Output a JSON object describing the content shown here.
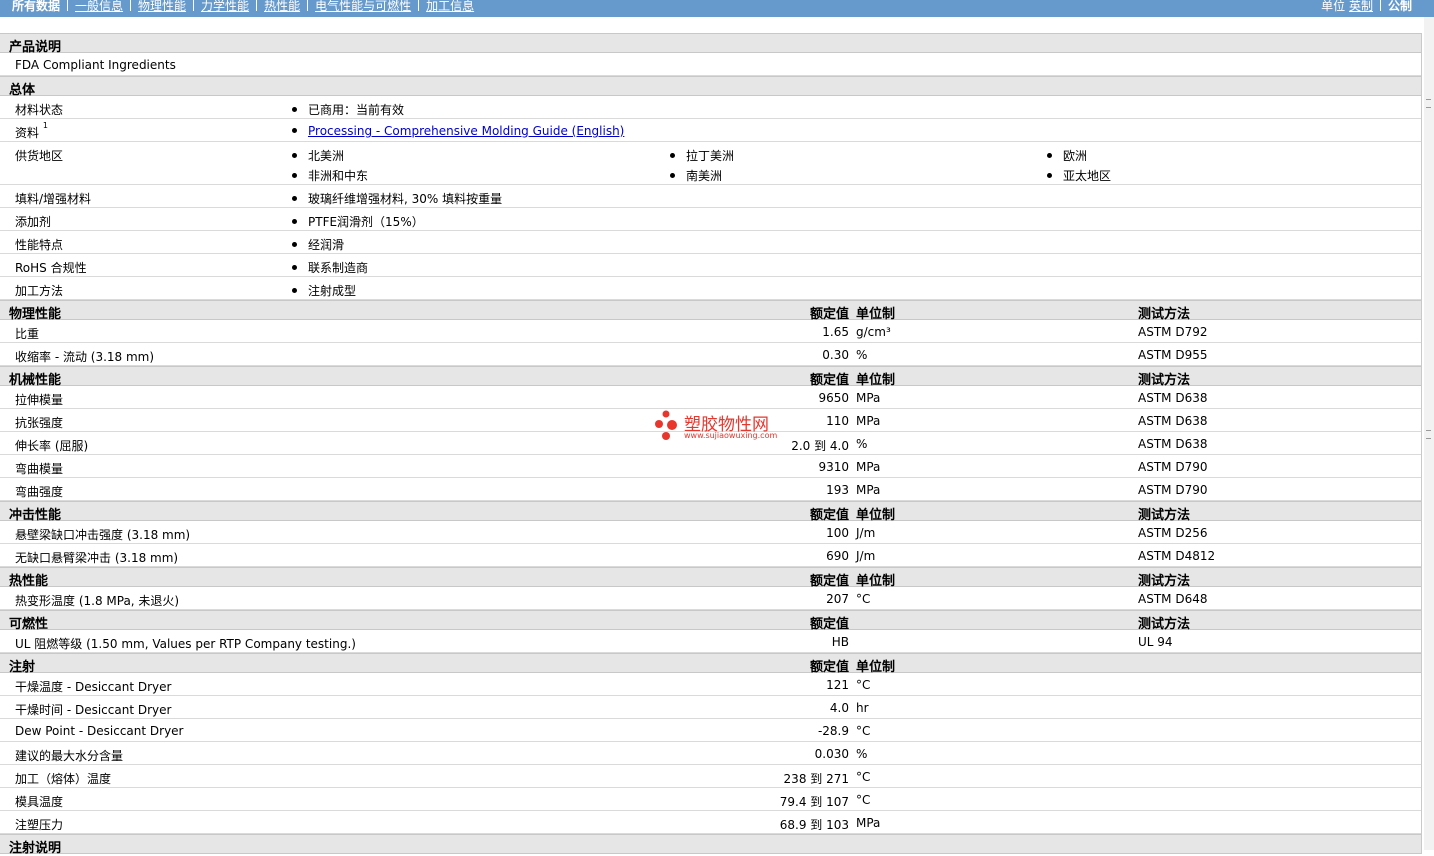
{
  "nav": {
    "tabs": [
      {
        "label": "所有数据",
        "active": true
      },
      {
        "label": "一般信息",
        "active": false
      },
      {
        "label": "物理性能",
        "active": false
      },
      {
        "label": "力学性能",
        "active": false
      },
      {
        "label": "热性能",
        "active": false
      },
      {
        "label": "电气性能与可燃性",
        "active": false
      },
      {
        "label": "加工信息",
        "active": false
      }
    ],
    "units_label": "单位",
    "units_imperial": "英制",
    "units_metric": "公制"
  },
  "watermark": {
    "name": "塑胶物性网",
    "url": "www.sujiaowuxing.com"
  },
  "product_description": {
    "title": "产品说明",
    "text": "FDA Compliant Ingredients"
  },
  "general": {
    "title": "总体",
    "material_status": {
      "label": "材料状态",
      "value": "已商用：当前有效"
    },
    "literature": {
      "label": "资料",
      "sup": "1",
      "link": "Processing - Comprehensive Molding Guide (English)"
    },
    "supply_region": {
      "label": "供货地区",
      "regions": [
        "北美洲",
        "拉丁美洲",
        "欧洲",
        "非洲和中东",
        "南美洲",
        "亚太地区"
      ]
    },
    "filler": {
      "label": "填料/增强材料",
      "value": "玻璃纤维增强材料, 30% 填料按重量"
    },
    "additive": {
      "label": "添加剂",
      "value": "PTFE润滑剂（15%）"
    },
    "features": {
      "label": "性能特点",
      "value": "经润滑"
    },
    "rohs": {
      "label": "RoHS 合规性",
      "value": "联系制造商"
    },
    "processing_method": {
      "label": "加工方法",
      "value": "注射成型"
    }
  },
  "headers": {
    "nominal": "额定值",
    "unit": "单位制",
    "test": "测试方法"
  },
  "physical": {
    "title": "物理性能",
    "rows": [
      {
        "label": "比重",
        "value": "1.65",
        "unit": "g/cm³",
        "test": "ASTM D792"
      },
      {
        "label": "收缩率  - 流动  (3.18 mm)",
        "value": "0.30",
        "unit": "%",
        "test": "ASTM D955"
      }
    ]
  },
  "mechanical": {
    "title": "机械性能",
    "rows": [
      {
        "label": "拉伸模量",
        "value": "9650",
        "unit": "MPa",
        "test": "ASTM D638"
      },
      {
        "label": "抗张强度",
        "value": "110",
        "unit": "MPa",
        "test": "ASTM D638"
      },
      {
        "label": "伸长率  (屈服)",
        "value": "2.0 到   4.0",
        "unit": "%",
        "test": "ASTM D638"
      },
      {
        "label": "弯曲模量",
        "value": "9310",
        "unit": "MPa",
        "test": "ASTM D790"
      },
      {
        "label": "弯曲强度",
        "value": "193",
        "unit": "MPa",
        "test": "ASTM D790"
      }
    ]
  },
  "impact": {
    "title": "冲击性能",
    "rows": [
      {
        "label": "悬壁梁缺口冲击强度  (3.18 mm)",
        "value": "100",
        "unit": "J/m",
        "test": "ASTM D256"
      },
      {
        "label": "无缺口悬臂梁冲击  (3.18 mm)",
        "value": "690",
        "unit": "J/m",
        "test": "ASTM D4812"
      }
    ]
  },
  "thermal": {
    "title": "热性能",
    "rows": [
      {
        "label": "热变形温度  (1.8 MPa, 未退火)",
        "value": "207",
        "unit": "°C",
        "test": "ASTM D648"
      }
    ]
  },
  "flammability": {
    "title": "可燃性",
    "rows": [
      {
        "label": "UL 阻燃等级  (1.50 mm, Values per RTP Company testing.)",
        "value": "HB",
        "unit": "",
        "test": "UL 94"
      }
    ]
  },
  "injection": {
    "title": "注射",
    "rows": [
      {
        "label": "干燥温度   - Desiccant Dryer",
        "value": "121",
        "unit": "°C"
      },
      {
        "label": "干燥时间   - Desiccant Dryer",
        "value": "4.0",
        "unit": "hr"
      },
      {
        "label": "Dew Point - Desiccant Dryer",
        "value": "-28.9",
        "unit": "°C"
      },
      {
        "label": "建议的最大水分含量",
        "value": "0.030",
        "unit": "%"
      },
      {
        "label": "加工（熔体）温度",
        "value": "238 到   271",
        "unit": "°C"
      },
      {
        "label": "模具温度",
        "value": "79.4 到   107",
        "unit": "°C"
      },
      {
        "label": "注塑压力",
        "value": "68.9 到   103",
        "unit": "MPa"
      }
    ]
  },
  "injection_notes": {
    "title": "注射说明"
  }
}
